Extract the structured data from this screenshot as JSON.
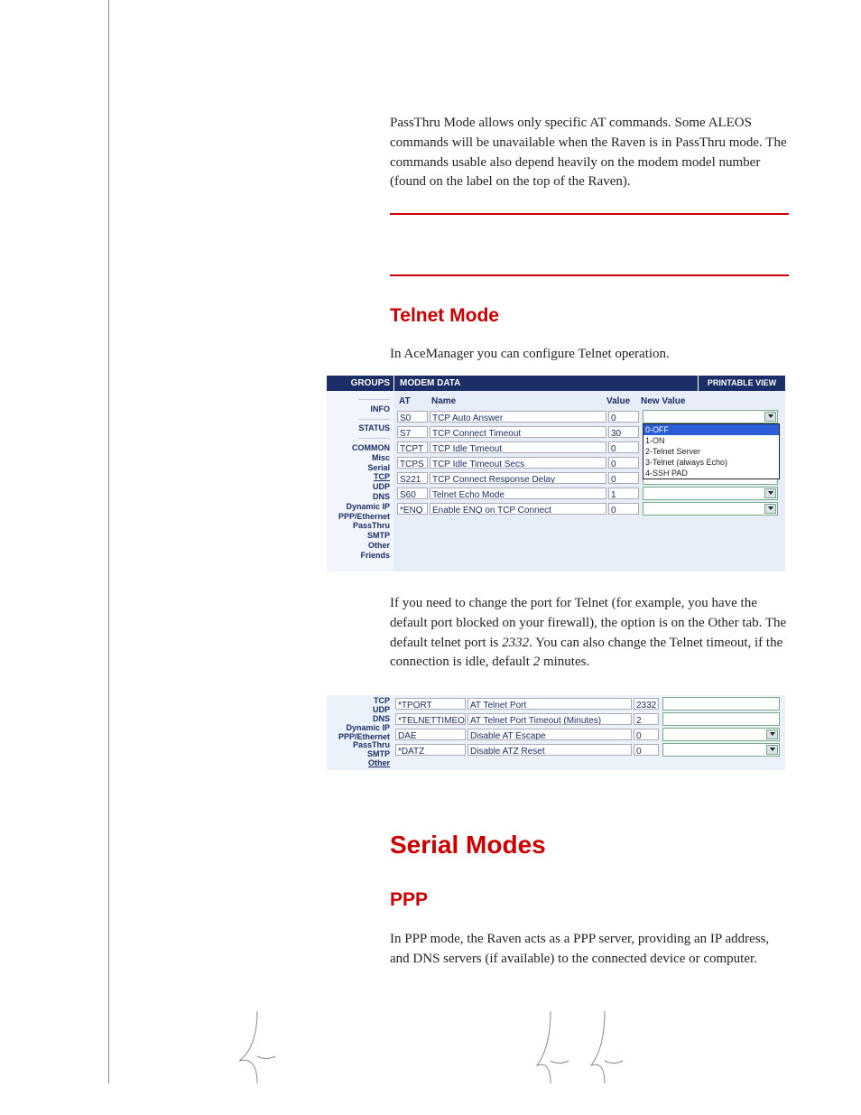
{
  "intro": "PassThru Mode allows only specific AT commands. Some ALEOS commands will be unavailable when the Raven is in PassThru mode. The commands usable also depend heavily on the modem model number (found on the label on the top of the Raven).",
  "telnet": {
    "heading": "Telnet Mode",
    "p1": "In AceManager you can configure Telnet operation.",
    "p2a": "If you need to change the port for Telnet (for example, you have the default port blocked on your firewall), the option is on the Other tab. The default telnet port is ",
    "p2_port": "2332",
    "p2b": ". You can also change the Telnet timeout, if the connection is idle, default ",
    "p2_min": "2",
    "p2c": " minutes."
  },
  "serial_h": "Serial Modes",
  "ppp": {
    "heading": "PPP",
    "p": "In PPP mode, the Raven acts as a PPP server, providing an IP address, and DNS servers (if available) to the connected device or computer."
  },
  "fig1": {
    "header": {
      "groups": "GROUPS",
      "modem": "MODEM DATA",
      "print": "PRINTABLE VIEW"
    },
    "left": {
      "div": "--------------",
      "info": "INFO",
      "status": "STATUS",
      "common": "COMMON",
      "misc": "Misc",
      "serial": "Serial",
      "tcp": "TCP",
      "udp": "UDP",
      "dns": "DNS",
      "dynip": "Dynamic IP",
      "ppp": "PPP/Ethernet",
      "pass": "PassThru",
      "smtp": "SMTP",
      "other": "Other",
      "friends": "Friends"
    },
    "cols": {
      "at": "AT",
      "name": "Name",
      "value": "Value",
      "new": "New Value"
    },
    "rows": [
      {
        "at": "S0",
        "name": "TCP Auto Answer",
        "value": "0",
        "control": "select_open"
      },
      {
        "at": "S7",
        "name": "TCP Connect Timeout",
        "value": "30",
        "control": "input"
      },
      {
        "at": "TCPT",
        "name": "TCP Idle Timeout",
        "value": "0",
        "control": "input"
      },
      {
        "at": "TCPS",
        "name": "TCP Idle Timeout Secs",
        "value": "0",
        "control": "input"
      },
      {
        "at": "S221",
        "name": "TCP Connect Response Delay",
        "value": "0",
        "control": "input"
      },
      {
        "at": "S60",
        "name": "Telnet Echo Mode",
        "value": "1",
        "control": "select"
      },
      {
        "at": "*ENQ",
        "name": "Enable ENQ on TCP Connect",
        "value": "0",
        "control": "select"
      }
    ],
    "dropdown_options": [
      "0-OFF",
      "1-ON",
      "2-Telnet Server",
      "3-Telnet (always Echo)",
      "4-SSH PAD"
    ]
  },
  "fig2": {
    "left": {
      "tcp": "TCP",
      "udp": "UDP",
      "dns": "DNS",
      "dynip": "Dynamic IP",
      "ppp": "PPP/Ethernet",
      "pass": "PassThru",
      "smtp": "SMTP",
      "other": "Other"
    },
    "rows": [
      {
        "at": "*TPORT",
        "name": "AT Telnet Port",
        "value": "2332",
        "control": "input"
      },
      {
        "at": "*TELNETTIMEOUT",
        "name": "AT Telnet Port Timeout (Minutes)",
        "value": "2",
        "control": "input"
      },
      {
        "at": "DAE",
        "name": "Disable AT Escape",
        "value": "0",
        "control": "select"
      },
      {
        "at": "*DATZ",
        "name": "Disable ATZ Reset",
        "value": "0",
        "control": "select"
      }
    ]
  }
}
